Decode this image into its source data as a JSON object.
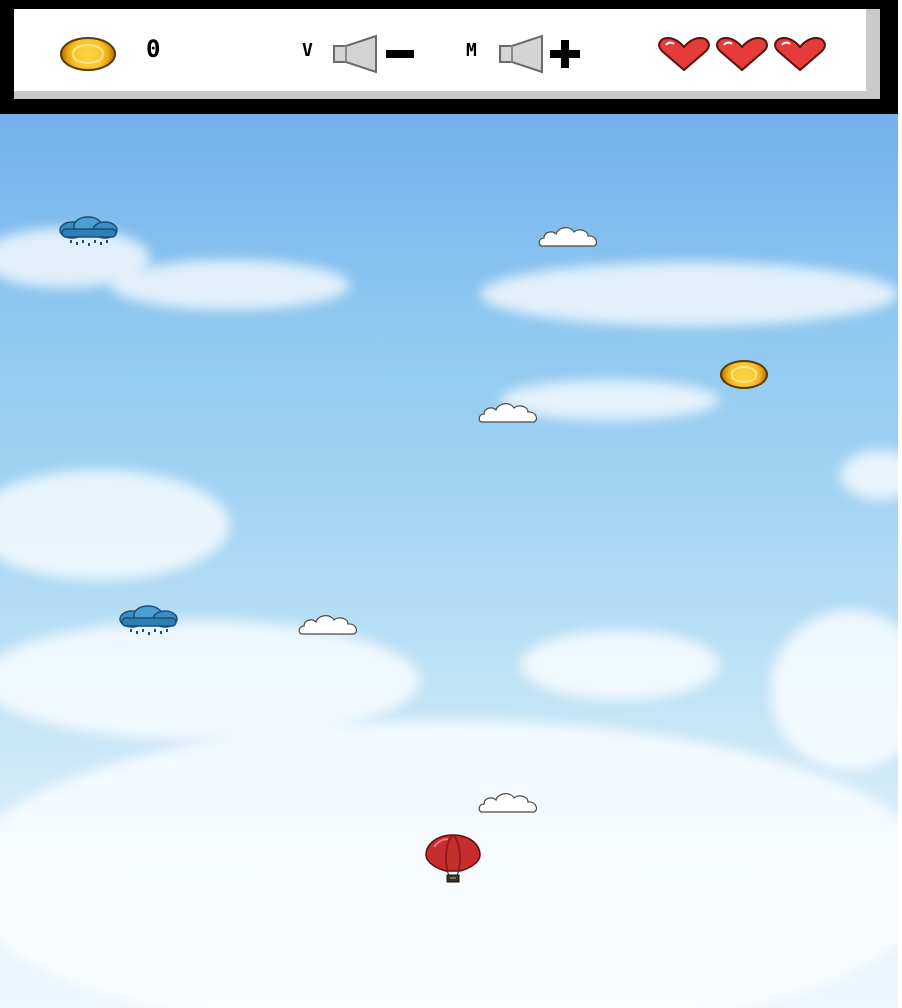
{
  "hud": {
    "score": "0",
    "volume_letter": "V",
    "music_letter": "M",
    "lives": 3
  },
  "objects": {
    "coin_pickups": 1,
    "rain_clouds": 2,
    "white_clouds": 4,
    "player": "hot-air-balloon"
  },
  "icons": {
    "coin": "coin-icon",
    "volume_down": "speaker-minus-icon",
    "music_up": "speaker-plus-icon",
    "life": "heart-icon",
    "rain_cloud": "rain-cloud-icon",
    "white_cloud": "cloud-icon",
    "player": "hot-air-balloon-icon"
  },
  "colors": {
    "heart": "#e53b3b",
    "coin": "#f7c22c",
    "balloon": "#c62d2d",
    "rain_cloud": "#2f7fb5"
  }
}
